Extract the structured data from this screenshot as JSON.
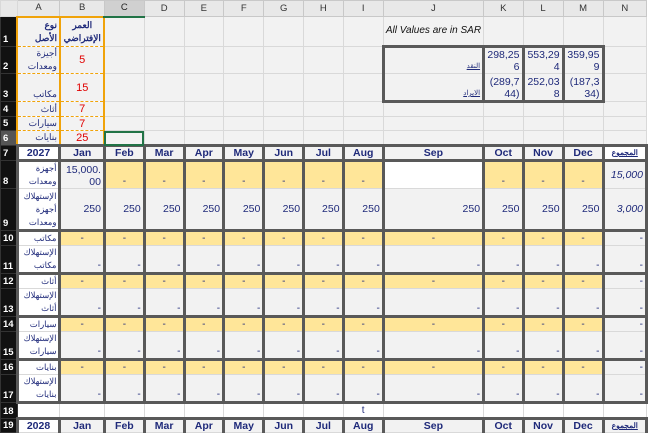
{
  "columns": [
    "A",
    "B",
    "C",
    "D",
    "E",
    "F",
    "G",
    "H",
    "I",
    "J",
    "K",
    "L",
    "M",
    "N"
  ],
  "selected_cell": "C6",
  "rows": [
    {
      "num": "1",
      "cells": [
        "نوع الأصل",
        "العمر الإفتراضي",
        "",
        "",
        "",
        "",
        "",
        "",
        "",
        "All Values are in SAR",
        "",
        "",
        "",
        ""
      ]
    },
    {
      "num": "2",
      "cells": [
        "أجيزة ومعدات",
        "5",
        "",
        "",
        "",
        "",
        "",
        "",
        "",
        "النقد",
        "298,256",
        "553,294",
        "359,959",
        ""
      ]
    },
    {
      "num": "3",
      "cells": [
        "مكاتب",
        "15",
        "",
        "",
        "",
        "",
        "",
        "",
        "",
        "الايراد",
        "(289,744)",
        "252,038",
        "(187,334)",
        ""
      ]
    },
    {
      "num": "4",
      "cells": [
        "أثاث",
        "7",
        "",
        "",
        "",
        "",
        "",
        "",
        "",
        "",
        "",
        "",
        "",
        ""
      ]
    },
    {
      "num": "5",
      "cells": [
        "سيارات",
        "7",
        "",
        "",
        "",
        "",
        "",
        "",
        "",
        "",
        "",
        "",
        "",
        ""
      ]
    },
    {
      "num": "6",
      "cells": [
        "بنايات",
        "25",
        "",
        "",
        "",
        "",
        "",
        "",
        "",
        "",
        "",
        "",
        "",
        ""
      ]
    },
    {
      "num": "7",
      "cells": [
        "2027",
        "Jan",
        "Feb",
        "Mar",
        "Apr",
        "May",
        "Jun",
        "Jul",
        "Aug",
        "Sep",
        "Oct",
        "Nov",
        "Dec",
        "المجموع"
      ]
    },
    {
      "num": "8",
      "cells": [
        "أجهزة ومعدات",
        "15,000.00",
        "-",
        "-",
        "-",
        "-",
        "-",
        "-",
        "-",
        "",
        "-",
        "-",
        "-",
        "15,000"
      ]
    },
    {
      "num": "9",
      "cells": [
        "الإستهلاك أجهزة ومعدات",
        "250",
        "250",
        "250",
        "250",
        "250",
        "250",
        "250",
        "250",
        "250",
        "250",
        "250",
        "250",
        "3,000"
      ]
    },
    {
      "num": "10",
      "cells": [
        "مكاتب",
        "-",
        "-",
        "-",
        "-",
        "-",
        "-",
        "-",
        "-",
        "-",
        "-",
        "-",
        "-",
        "-"
      ]
    },
    {
      "num": "11",
      "cells": [
        "الإستهلاك مكاتب",
        "-",
        "-",
        "-",
        "-",
        "-",
        "-",
        "-",
        "-",
        "-",
        "-",
        "-",
        "-",
        "-"
      ]
    },
    {
      "num": "12",
      "cells": [
        "أثاث",
        "-",
        "-",
        "-",
        "-",
        "-",
        "-",
        "-",
        "-",
        "-",
        "-",
        "-",
        "-",
        "-"
      ]
    },
    {
      "num": "13",
      "cells": [
        "الإستهلاك أثاث",
        "-",
        "-",
        "-",
        "-",
        "-",
        "-",
        "-",
        "-",
        "-",
        "-",
        "-",
        "-",
        "-"
      ]
    },
    {
      "num": "14",
      "cells": [
        "سيارات",
        "-",
        "-",
        "-",
        "-",
        "-",
        "-",
        "-",
        "-",
        "-",
        "-",
        "-",
        "-",
        "-"
      ]
    },
    {
      "num": "15",
      "cells": [
        "الإستهلاك سيارات",
        "-",
        "-",
        "-",
        "-",
        "-",
        "-",
        "-",
        "-",
        "-",
        "-",
        "-",
        "-",
        "-"
      ]
    },
    {
      "num": "16",
      "cells": [
        "بنايات",
        "-",
        "-",
        "-",
        "-",
        "-",
        "-",
        "-",
        "-",
        "-",
        "-",
        "-",
        "-",
        "-"
      ]
    },
    {
      "num": "17",
      "cells": [
        "الإستهلاك بنايات",
        "-",
        "-",
        "-",
        "-",
        "-",
        "-",
        "-",
        "-",
        "-",
        "-",
        "-",
        "-",
        "-"
      ]
    },
    {
      "num": "18",
      "cells": [
        "",
        "",
        "",
        "",
        "",
        "",
        "",
        "",
        "t",
        "",
        "",
        "",
        "",
        ""
      ]
    },
    {
      "num": "19",
      "cells": [
        "2028",
        "Jan",
        "Feb",
        "Mar",
        "Apr",
        "May",
        "Jun",
        "Jul",
        "Aug",
        "Sep",
        "Oct",
        "Nov",
        "Dec",
        "المجموع"
      ]
    }
  ],
  "colors": {
    "accent_yellow": "#ffe699",
    "asset_border": "#f0a30a",
    "selection": "#217346",
    "text_navy": "#1f2a7a",
    "life_red": "#e00000"
  }
}
